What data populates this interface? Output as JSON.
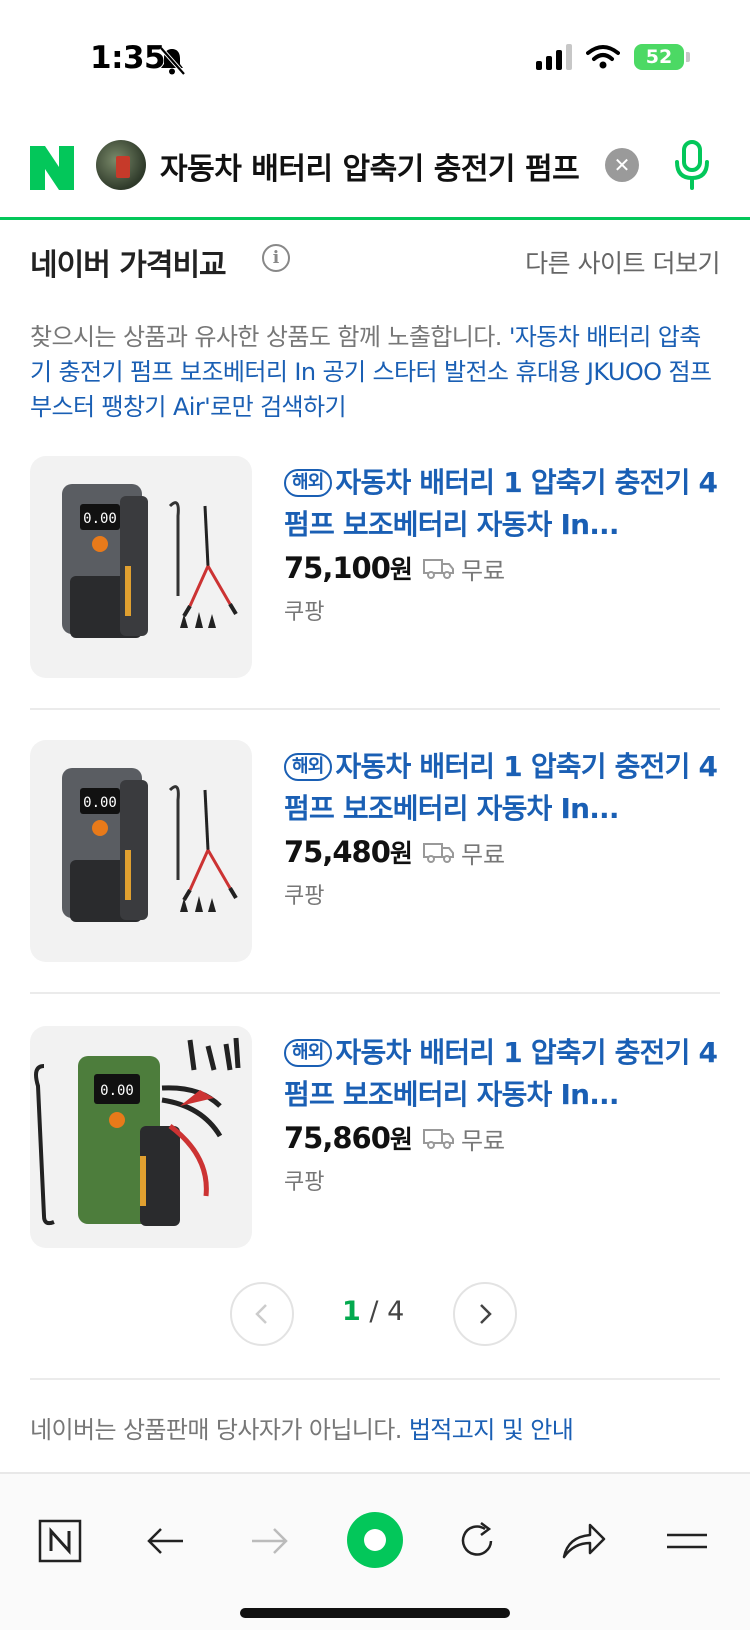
{
  "status_bar": {
    "time": "1:35",
    "battery": "52"
  },
  "search": {
    "logo": "N",
    "query": "자동차 배터리 압축기 충전기 펌프"
  },
  "section": {
    "title": "네이버 가격비교",
    "more_link": "다른 사이트 더보기",
    "notice_text": "찾으시는 상품과 유사한 상품도 함께 노출합니다. ",
    "notice_link": "'자동차 배터리 압축기 충전기 펌프 보조베터리 In 공기 스타터 발전소 휴대용 JKUOO 점프 부스터 팽창기 Air'로만 검색하기"
  },
  "products": [
    {
      "badge": "해외",
      "name": "자동차 배터리 1 압축기 충전기 4 펌프 보조베터리 자동차 In...",
      "price": "75,100",
      "price_unit": "원",
      "shipping": "무료",
      "store": "쿠팡",
      "image_color": "gray"
    },
    {
      "badge": "해외",
      "name": "자동차 배터리 1 압축기 충전기 4 펌프 보조베터리 자동차 In...",
      "price": "75,480",
      "price_unit": "원",
      "shipping": "무료",
      "store": "쿠팡",
      "image_color": "gray"
    },
    {
      "badge": "해외",
      "name": "자동차 배터리 1 압축기 충전기 4 펌프 보조베터리 자동차 In...",
      "price": "75,860",
      "price_unit": "원",
      "shipping": "무료",
      "store": "쿠팡",
      "image_color": "green"
    }
  ],
  "pagination": {
    "current": "1",
    "separator": " / ",
    "total": "4"
  },
  "disclaimer": {
    "text": "네이버는 상품판매 당사자가 아닙니다. ",
    "link": "법적고지 및 안내"
  },
  "colors": {
    "naver_green": "#03c75a",
    "link_blue": "#1a5fb4"
  }
}
